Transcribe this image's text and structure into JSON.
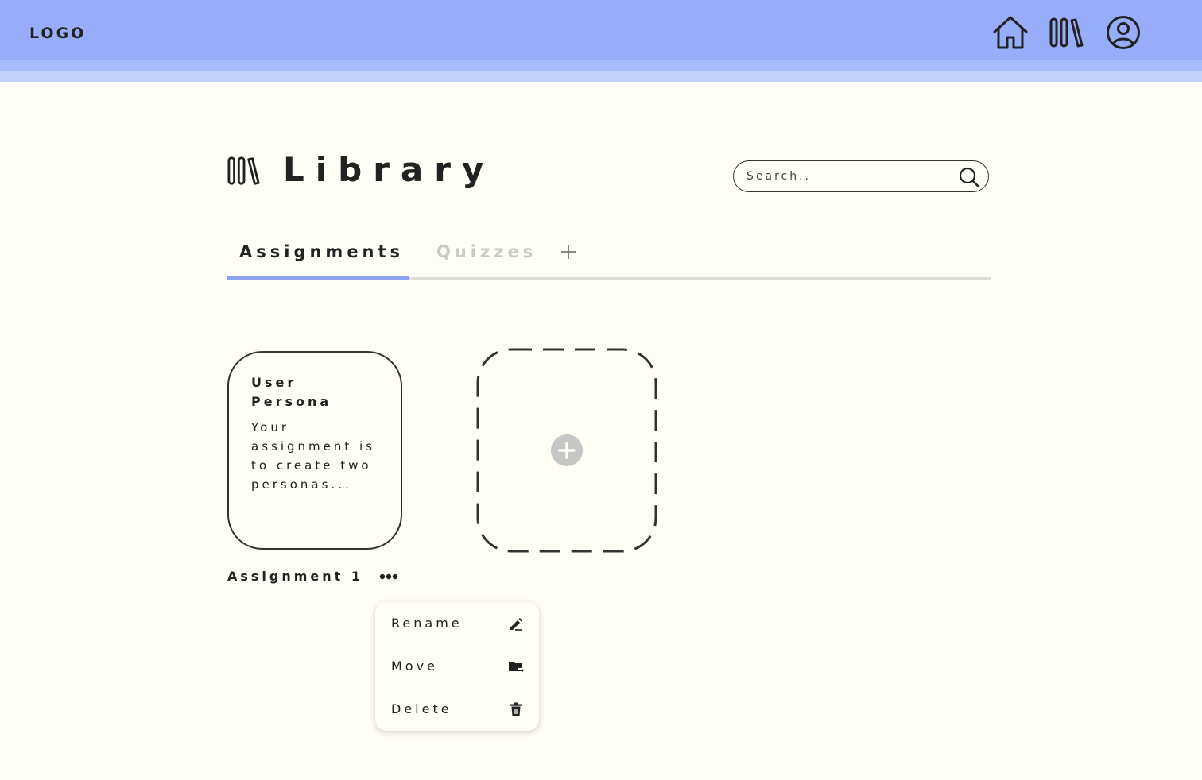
{
  "header": {
    "logo": "LOGO",
    "nav": [
      {
        "icon": "home-icon"
      },
      {
        "icon": "library-icon"
      },
      {
        "icon": "profile-icon"
      }
    ],
    "colors": {
      "bar": "#97adf9",
      "stripe1": "#a9bcfb",
      "stripe2": "#c3d0fc"
    }
  },
  "page": {
    "title": "Library",
    "icon": "library-icon"
  },
  "search": {
    "placeholder": "Search..",
    "icon": "search-icon"
  },
  "tabs": [
    {
      "label": "Assignments",
      "active": true
    },
    {
      "label": "Quizzes",
      "active": false
    }
  ],
  "tab_add_icon": "plus-icon",
  "accent_color": "#8aa2f0",
  "assignments": [
    {
      "card_title": "User Persona",
      "card_description": "Your assignment is to create two personas...",
      "caption": "Assignment 1",
      "more_icon": "more-horizontal-icon"
    }
  ],
  "add_card_icon": "plus-circle-icon",
  "context_menu": {
    "items": [
      {
        "label": "Rename",
        "icon": "edit-pencil-icon"
      },
      {
        "label": "Move",
        "icon": "folder-move-icon"
      },
      {
        "label": "Delete",
        "icon": "trash-icon"
      }
    ]
  }
}
